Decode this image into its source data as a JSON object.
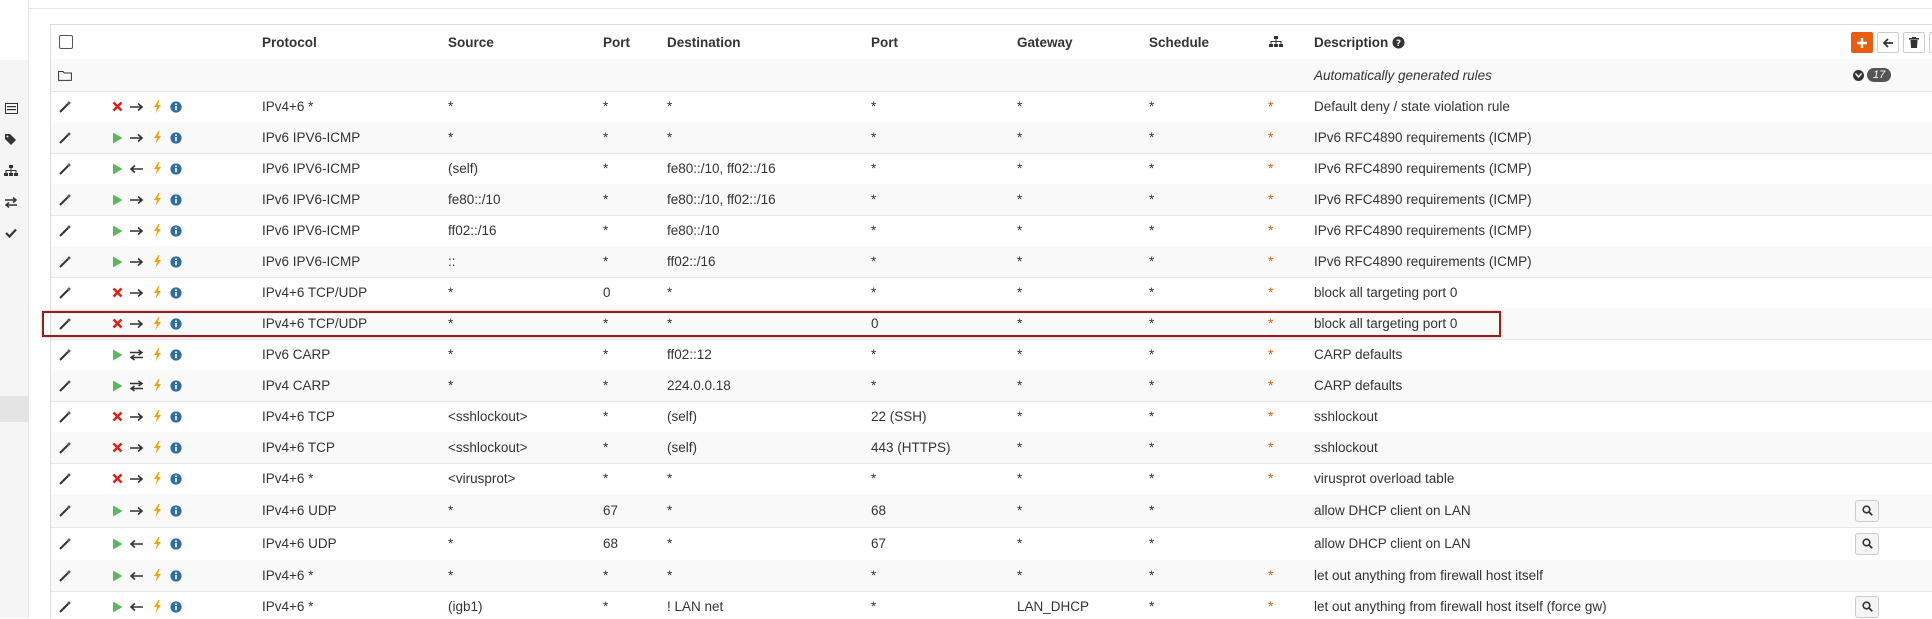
{
  "header": {
    "protocol": "Protocol",
    "source": "Source",
    "source_port": "Port",
    "destination": "Destination",
    "destination_port": "Port",
    "gateway": "Gateway",
    "schedule": "Schedule",
    "description": "Description"
  },
  "auto_rules": {
    "label": "Automatically generated rules",
    "count": "17"
  },
  "colors": {
    "block": "#d9241c",
    "pass": "#5cb85c",
    "lightning": "#f0a30a",
    "info": "#2f6da3",
    "star": "#e65c00",
    "add_button": "#e85d0f",
    "highlight": "#9c1c1c"
  },
  "rules": [
    {
      "action": "block",
      "direction": "out",
      "protocol": "IPv4+6 *",
      "source": "*",
      "source_port": "*",
      "destination": "*",
      "destination_port": "*",
      "gateway": "*",
      "schedule": "*",
      "star": "*",
      "description": "Default deny / state violation rule",
      "lookup": false
    },
    {
      "action": "pass",
      "direction": "out",
      "protocol": "IPv6 IPV6-ICMP",
      "source": "*",
      "source_port": "*",
      "destination": "*",
      "destination_port": "*",
      "gateway": "*",
      "schedule": "*",
      "star": "*",
      "description": "IPv6 RFC4890 requirements (ICMP)",
      "lookup": false
    },
    {
      "action": "pass",
      "direction": "in",
      "protocol": "IPv6 IPV6-ICMP",
      "source": "(self)",
      "source_port": "*",
      "destination": "fe80::/10, ff02::/16",
      "destination_port": "*",
      "gateway": "*",
      "schedule": "*",
      "star": "*",
      "description": "IPv6 RFC4890 requirements (ICMP)",
      "lookup": false
    },
    {
      "action": "pass",
      "direction": "out",
      "protocol": "IPv6 IPV6-ICMP",
      "source": "fe80::/10",
      "source_port": "*",
      "destination": "fe80::/10, ff02::/16",
      "destination_port": "*",
      "gateway": "*",
      "schedule": "*",
      "star": "*",
      "description": "IPv6 RFC4890 requirements (ICMP)",
      "lookup": false
    },
    {
      "action": "pass",
      "direction": "out",
      "protocol": "IPv6 IPV6-ICMP",
      "source": "ff02::/16",
      "source_port": "*",
      "destination": "fe80::/10",
      "destination_port": "*",
      "gateway": "*",
      "schedule": "*",
      "star": "*",
      "description": "IPv6 RFC4890 requirements (ICMP)",
      "lookup": false
    },
    {
      "action": "pass",
      "direction": "out",
      "protocol": "IPv6 IPV6-ICMP",
      "source": "::",
      "source_port": "*",
      "destination": "ff02::/16",
      "destination_port": "*",
      "gateway": "*",
      "schedule": "*",
      "star": "*",
      "description": "IPv6 RFC4890 requirements (ICMP)",
      "lookup": false
    },
    {
      "action": "block",
      "direction": "out",
      "protocol": "IPv4+6 TCP/UDP",
      "source": "*",
      "source_port": "0",
      "destination": "*",
      "destination_port": "*",
      "gateway": "*",
      "schedule": "*",
      "star": "*",
      "description": "block all targeting port 0",
      "lookup": false
    },
    {
      "action": "block",
      "direction": "out",
      "protocol": "IPv4+6 TCP/UDP",
      "source": "*",
      "source_port": "*",
      "destination": "*",
      "destination_port": "0",
      "gateway": "*",
      "schedule": "*",
      "star": "*",
      "description": "block all targeting port 0",
      "lookup": false
    },
    {
      "action": "pass",
      "direction": "both",
      "protocol": "IPv6 CARP",
      "source": "*",
      "source_port": "*",
      "destination": "ff02::12",
      "destination_port": "*",
      "gateway": "*",
      "schedule": "*",
      "star": "*",
      "description": "CARP defaults",
      "lookup": false
    },
    {
      "action": "pass",
      "direction": "both",
      "protocol": "IPv4 CARP",
      "source": "*",
      "source_port": "*",
      "destination": "224.0.0.18",
      "destination_port": "*",
      "gateway": "*",
      "schedule": "*",
      "star": "*",
      "description": "CARP defaults",
      "lookup": false
    },
    {
      "action": "block",
      "direction": "out",
      "protocol": "IPv4+6 TCP",
      "source": "<sshlockout>",
      "source_port": "*",
      "destination": "(self)",
      "destination_port": "22 (SSH)",
      "gateway": "*",
      "schedule": "*",
      "star": "*",
      "description": "sshlockout",
      "lookup": false
    },
    {
      "action": "block",
      "direction": "out",
      "protocol": "IPv4+6 TCP",
      "source": "<sshlockout>",
      "source_port": "*",
      "destination": "(self)",
      "destination_port": "443 (HTTPS)",
      "gateway": "*",
      "schedule": "*",
      "star": "*",
      "description": "sshlockout",
      "lookup": false
    },
    {
      "action": "block",
      "direction": "out",
      "protocol": "IPv4+6 *",
      "source": "<virusprot>",
      "source_port": "*",
      "destination": "*",
      "destination_port": "*",
      "gateway": "*",
      "schedule": "*",
      "star": "*",
      "description": "virusprot overload table",
      "lookup": false
    },
    {
      "action": "pass",
      "direction": "out",
      "protocol": "IPv4+6 UDP",
      "source": "*",
      "source_port": "67",
      "destination": "*",
      "destination_port": "68",
      "gateway": "*",
      "schedule": "*",
      "star": "",
      "description": "allow DHCP client on LAN",
      "lookup": true
    },
    {
      "action": "pass",
      "direction": "in",
      "protocol": "IPv4+6 UDP",
      "source": "*",
      "source_port": "68",
      "destination": "*",
      "destination_port": "67",
      "gateway": "*",
      "schedule": "*",
      "star": "",
      "description": "allow DHCP client on LAN",
      "lookup": true
    },
    {
      "action": "pass",
      "direction": "in",
      "protocol": "IPv4+6 *",
      "source": "*",
      "source_port": "*",
      "destination": "*",
      "destination_port": "*",
      "gateway": "*",
      "schedule": "*",
      "star": "*",
      "description": "let out anything from firewall host itself",
      "lookup": false
    },
    {
      "action": "pass",
      "direction": "in",
      "protocol": "IPv4+6 *",
      "source": "(igb1)",
      "source_port": "*",
      "destination": "! LAN net",
      "destination_port": "*",
      "gateway": "LAN_DHCP",
      "schedule": "*",
      "star": "*",
      "description": "let out anything from firewall host itself (force gw)",
      "lookup": true
    }
  ]
}
